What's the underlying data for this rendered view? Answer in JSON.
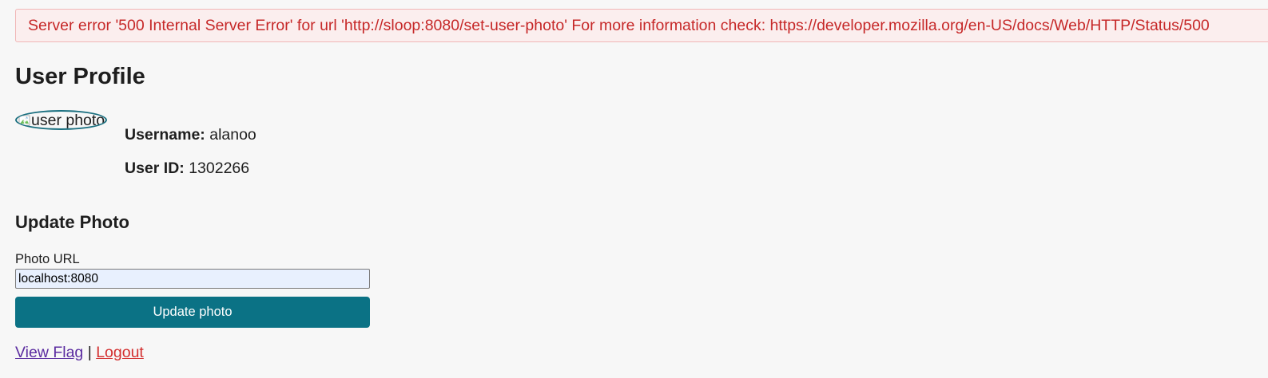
{
  "error": {
    "message": "Server error '500 Internal Server Error' for url 'http://sloop:8080/set-user-photo' For more information check: https://developer.mozilla.org/en-US/docs/Web/HTTP/Status/500",
    "color": "#c62828"
  },
  "profile": {
    "title": "User Profile",
    "photo_alt": "user photo",
    "photo_icon": "broken-image-icon",
    "username_label": "Username:",
    "username": "alanoo",
    "userid_label": "User ID:",
    "userid": "1302266"
  },
  "update_photo": {
    "title": "Update Photo",
    "field_label": "Photo URL",
    "field_value": "localhost:8080",
    "button_label": "Update photo",
    "button_color": "#0b7285"
  },
  "links": {
    "view_flag": "View Flag",
    "separator": "|",
    "logout": "Logout"
  }
}
